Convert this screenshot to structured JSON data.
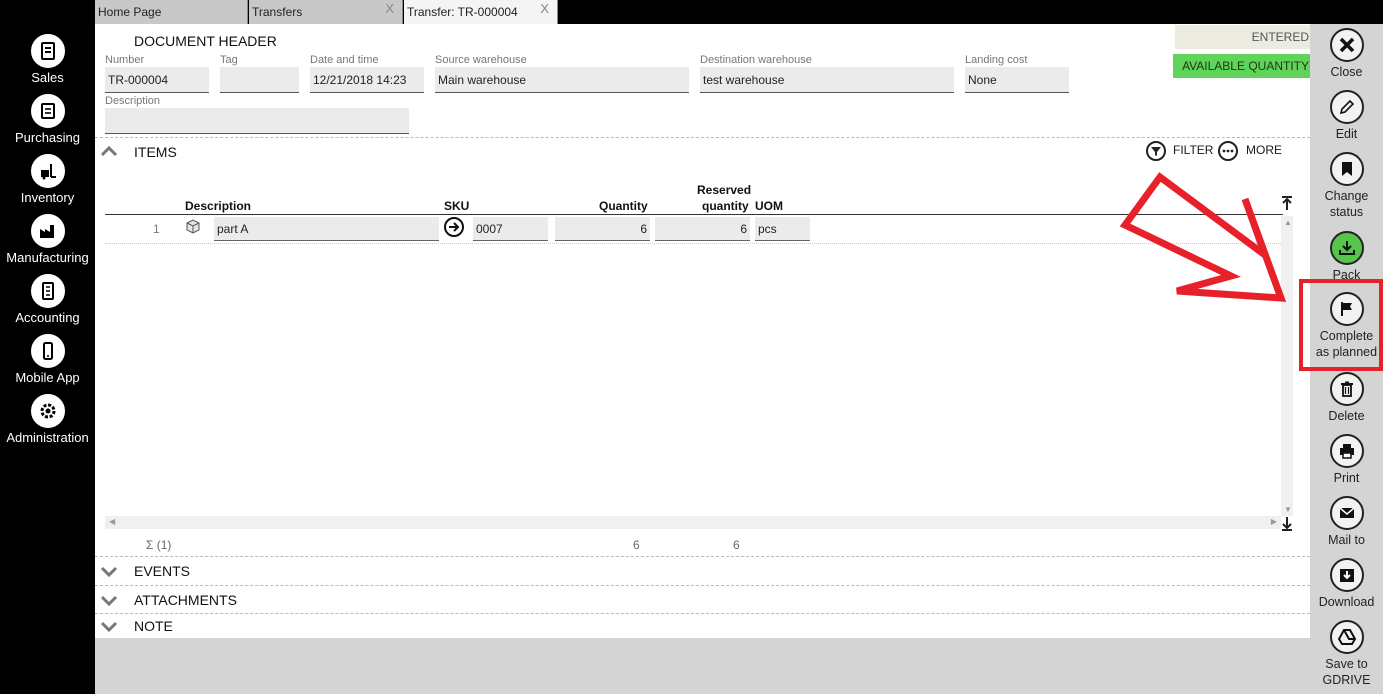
{
  "nav": {
    "items": [
      {
        "label": "Sales",
        "icon": "sales-icon"
      },
      {
        "label": "Purchasing",
        "icon": "purchasing-icon"
      },
      {
        "label": "Inventory",
        "icon": "inventory-icon"
      },
      {
        "label": "Manufacturing",
        "icon": "manufacturing-icon"
      },
      {
        "label": "Accounting",
        "icon": "accounting-icon"
      },
      {
        "label": "Mobile App",
        "icon": "mobile-icon"
      },
      {
        "label": "Administration",
        "icon": "gear-icon"
      }
    ]
  },
  "tabs": [
    {
      "label": "Home Page"
    },
    {
      "label": "Transfers",
      "close": "X"
    },
    {
      "label": "Transfer: TR-000004",
      "close": "X"
    }
  ],
  "header": {
    "title": "DOCUMENT HEADER",
    "number_label": "Number",
    "number": "TR-000004",
    "tag_label": "Tag",
    "tag": "",
    "date_label": "Date and time",
    "date": "12/21/2018 14:23",
    "source_label": "Source warehouse",
    "source": "Main warehouse",
    "dest_label": "Destination warehouse",
    "dest": "test warehouse",
    "landing_label": "Landing cost",
    "landing": "None",
    "description_label": "Description",
    "description": ""
  },
  "status": {
    "entered": "ENTERED",
    "available": "AVAILABLE QUANTITY",
    "available_color": "#5fd35a"
  },
  "items": {
    "title": "ITEMS",
    "filter": "FILTER",
    "more": "MORE",
    "columns": {
      "description": "Description",
      "sku": "SKU",
      "quantity": "Quantity",
      "reserved_1": "Reserved",
      "reserved_2": "quantity",
      "uom": "UOM"
    },
    "rows": [
      {
        "index": "1",
        "description": "part A",
        "sku": "0007",
        "quantity": "6",
        "reserved": "6",
        "uom": "pcs"
      }
    ],
    "footer": {
      "count": "Σ (1)",
      "quantity_total": "6",
      "reserved_total": "6"
    }
  },
  "sections": {
    "events": "EVENTS",
    "attachments": "ATTACHMENTS",
    "note": "NOTE"
  },
  "toolbar": {
    "close": "Close",
    "edit": "Edit",
    "change_status_1": "Change",
    "change_status_2": "status",
    "pack": "Pack",
    "complete_1": "Complete",
    "complete_2": "as planned",
    "delete": "Delete",
    "print": "Print",
    "mail": "Mail to",
    "download": "Download",
    "gdrive_1": "Save to",
    "gdrive_2": "GDRIVE"
  },
  "annotation_color": "#e8202a"
}
